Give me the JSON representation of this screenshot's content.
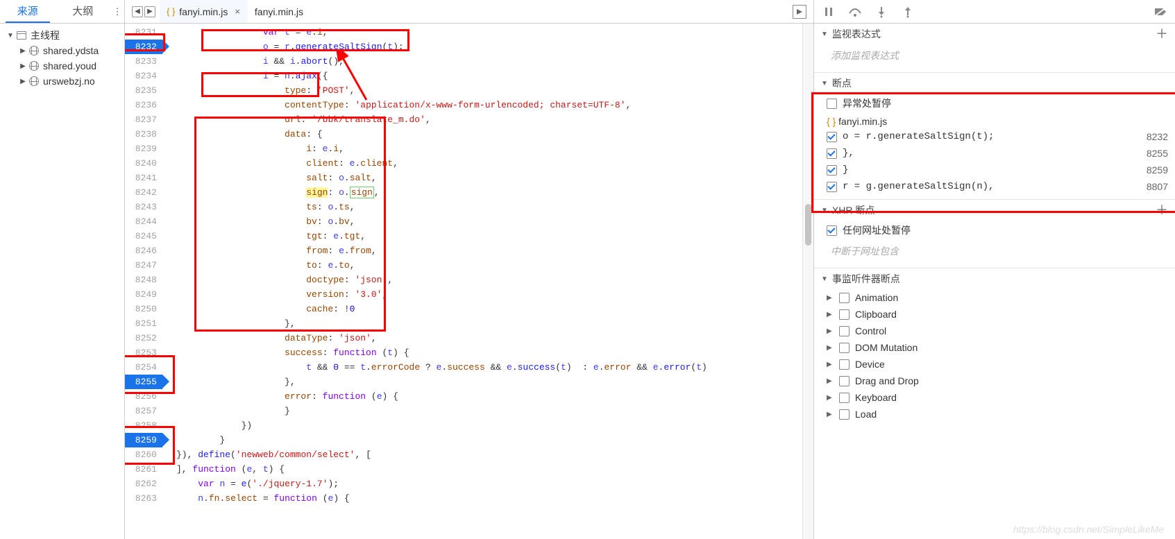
{
  "left": {
    "tabs": {
      "sources": "来源",
      "outline": "大纲"
    },
    "root": "主线程",
    "children": [
      "shared.ydsta",
      "shared.youd",
      "urswebzj.no"
    ]
  },
  "tabs": {
    "active": "fanyi.min.js",
    "inactive": "fanyi.min.js"
  },
  "gutter_start": 8231,
  "gutter_end": 8263,
  "breakpoint_lines": [
    8232,
    8255,
    8259
  ],
  "code_lines": [
    {
      "n": 8231,
      "html": "<span class='kw'>var</span> <span class='ident'>t</span> = <span class='ident'>e</span>.<span class='prop'>i</span>,"
    },
    {
      "n": 8232,
      "html": "<span class='ident'>o</span> = <span class='ident'>r</span>.<span class='fn'>generateSaltSign</span>(<span class='ident'>t</span>);"
    },
    {
      "n": 8233,
      "html": "<span class='ident'>i</span> && <span class='ident'>i</span>.<span class='fn'>abort</span>(),"
    },
    {
      "n": 8234,
      "html": "<span class='ident'>i</span> = <span class='ident'>n</span>.<span class='fn'>ajax</span>({"
    },
    {
      "n": 8235,
      "html": "    <span class='prop'>type</span>: <span class='str'>'POST'</span>,"
    },
    {
      "n": 8236,
      "html": "    <span class='prop'>contentType</span>: <span class='str'>'application/x-www-form-urlencoded; charset=UTF-8'</span>,"
    },
    {
      "n": 8237,
      "html": "    <span class='prop'>url</span>: <span class='str'>'/bbk/translate_m.do'</span>,"
    },
    {
      "n": 8238,
      "html": "    <span class='prop'>data</span>: {"
    },
    {
      "n": 8239,
      "html": "        <span class='prop'>i</span>: <span class='ident'>e</span>.<span class='prop'>i</span>,"
    },
    {
      "n": 8240,
      "html": "        <span class='prop'>client</span>: <span class='ident'>e</span>.<span class='prop'>client</span>,"
    },
    {
      "n": 8241,
      "html": "        <span class='prop'>salt</span>: <span class='ident'>o</span>.<span class='prop'>salt</span>,"
    },
    {
      "n": 8242,
      "html": "        <span class='hl'><span class='prop'>sign</span></span>: <span class='ident'>o</span>.<span class='border-green'><span class='prop'>sign</span></span>,"
    },
    {
      "n": 8243,
      "html": "        <span class='prop'>ts</span>: <span class='ident'>o</span>.<span class='prop'>ts</span>,"
    },
    {
      "n": 8244,
      "html": "        <span class='prop'>bv</span>: <span class='ident'>o</span>.<span class='prop'>bv</span>,"
    },
    {
      "n": 8245,
      "html": "        <span class='prop'>tgt</span>: <span class='ident'>e</span>.<span class='prop'>tgt</span>,"
    },
    {
      "n": 8246,
      "html": "        <span class='prop'>from</span>: <span class='ident'>e</span>.<span class='prop'>from</span>,"
    },
    {
      "n": 8247,
      "html": "        <span class='prop'>to</span>: <span class='ident'>e</span>.<span class='prop'>to</span>,"
    },
    {
      "n": 8248,
      "html": "        <span class='prop'>doctype</span>: <span class='str'>'json'</span>,"
    },
    {
      "n": 8249,
      "html": "        <span class='prop'>version</span>: <span class='str'>'3.0'</span>,"
    },
    {
      "n": 8250,
      "html": "        <span class='prop'>cache</span>: !<span class='num'>0</span>"
    },
    {
      "n": 8251,
      "html": "    },"
    },
    {
      "n": 8252,
      "html": "    <span class='prop'>dataType</span>: <span class='str'>'json'</span>,"
    },
    {
      "n": 8253,
      "html": "    <span class='prop'>success</span>: <span class='kw'>function</span> (<span class='ident'>t</span>) {"
    },
    {
      "n": 8254,
      "html": "        <span class='ident'>t</span> && <span class='num'>0</span> == <span class='ident'>t</span>.<span class='prop'>errorCode</span> ? <span class='ident'>e</span>.<span class='prop'>success</span> && <span class='ident'>e</span>.<span class='fn'>success</span>(<span class='ident'>t</span>)  : <span class='ident'>e</span>.<span class='prop'>error</span> && <span class='ident'>e</span>.<span class='fn'>error</span>(<span class='ident'>t</span>)"
    },
    {
      "n": 8255,
      "html": "    },"
    },
    {
      "n": 8256,
      "html": "    <span class='prop'>error</span>: <span class='kw'>function</span> (<span class='ident'>e</span>) {"
    },
    {
      "n": 8257,
      "html": "    }"
    },
    {
      "n": 8258,
      "html": "})"
    },
    {
      "n": 8259,
      "html": "}"
    },
    {
      "n": 8260,
      "html": "}), <span class='fn'>define</span>(<span class='str'>'newweb/common/select'</span>, ["
    },
    {
      "n": 8261,
      "html": "], <span class='kw'>function</span> (<span class='ident'>e</span>, <span class='ident'>t</span>) {"
    },
    {
      "n": 8262,
      "html": "<span class='kw'>var</span> <span class='ident'>n</span> = <span class='fn'>e</span>(<span class='str'>'./jquery-1.7'</span>);"
    },
    {
      "n": 8263,
      "html": "<span class='ident'>n</span>.<span class='prop'>fn</span>.<span class='prop'>select</span> = <span class='kw'>function</span> (<span class='ident'>e</span>) {"
    }
  ],
  "code_indents": {
    "8231": 4,
    "8232": 4,
    "8233": 4,
    "8234": 4,
    "8235": 4,
    "8236": 4,
    "8237": 4,
    "8238": 4,
    "8239": 4,
    "8240": 4,
    "8241": 4,
    "8242": 4,
    "8243": 4,
    "8244": 4,
    "8245": 4,
    "8246": 4,
    "8247": 4,
    "8248": 4,
    "8249": 4,
    "8250": 4,
    "8251": 4,
    "8252": 4,
    "8253": 4,
    "8254": 4,
    "8255": 4,
    "8256": 4,
    "8257": 4,
    "8258": 3,
    "8259": 2,
    "8260": 0,
    "8261": 0,
    "8262": 1,
    "8263": 1
  },
  "right": {
    "watch": {
      "title": "监视表达式",
      "empty": "添加监视表达式"
    },
    "breakpoints": {
      "title": "断点",
      "pause_exc": "异常处暂停",
      "file": "fanyi.min.js",
      "items": [
        {
          "checked": true,
          "code": "o = r.generateSaltSign(t);",
          "line": 8232
        },
        {
          "checked": true,
          "code": "},",
          "line": 8255
        },
        {
          "checked": true,
          "code": "}",
          "line": 8259
        },
        {
          "checked": true,
          "code": "r = g.generateSaltSign(n),",
          "line": 8807
        }
      ]
    },
    "xhr": {
      "title": "XHR 断点",
      "any": "任何网址处暂停",
      "empty": "中断于网址包含"
    },
    "events": {
      "title": "事监听件器断点",
      "cats": [
        "Animation",
        "Clipboard",
        "Control",
        "DOM Mutation",
        "Device",
        "Drag and Drop",
        "Keyboard",
        "Load"
      ]
    }
  },
  "watermark": "https://blog.csdn.net/SimpleLikeMe"
}
